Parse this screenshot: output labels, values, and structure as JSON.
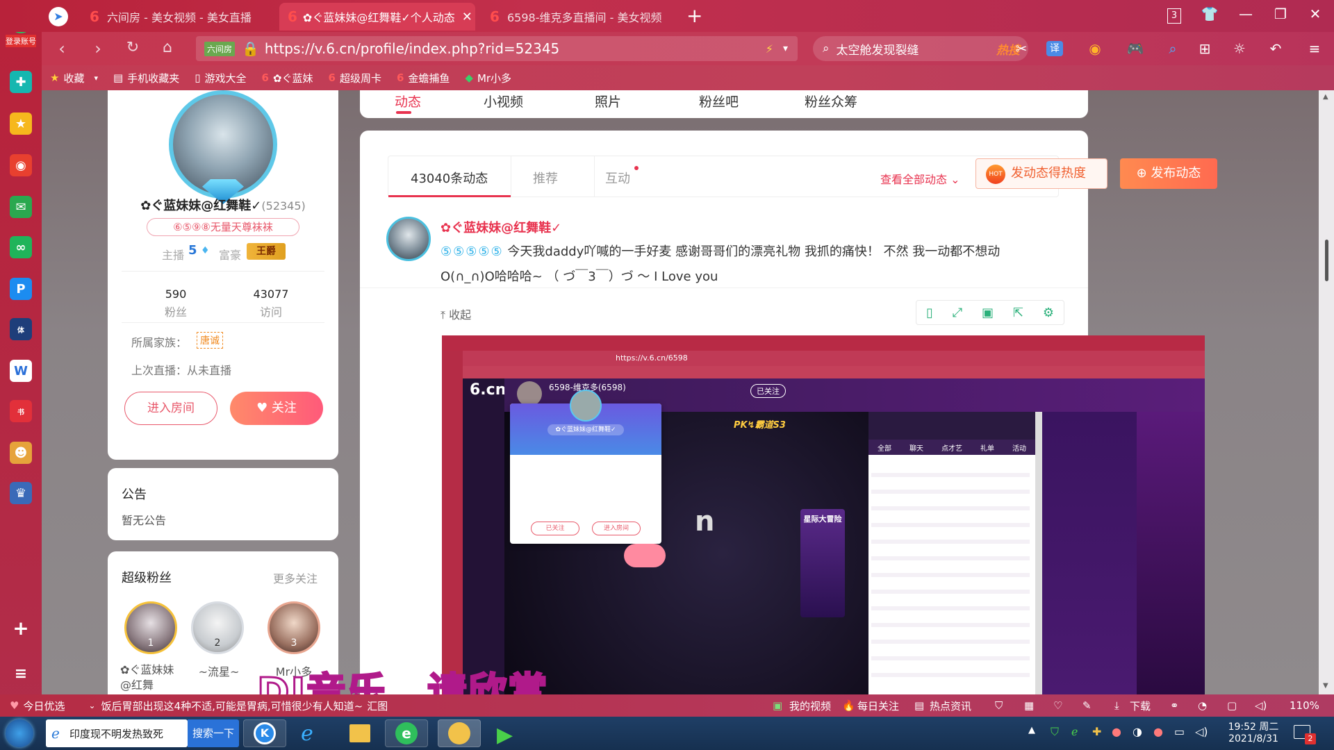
{
  "browser": {
    "sidebar_logo_label": "登录账号",
    "tabs": [
      {
        "label": "六间房 - 美女视频 - 美女直播",
        "active": false
      },
      {
        "label": "✿ぐ蓝妹妹@红舞鞋✓个人动态",
        "active": true
      },
      {
        "label": "6598-维克多直播间 - 美女视频",
        "active": false
      }
    ],
    "new_tab": "+",
    "tab_counter": "3",
    "url_tag": "六间房",
    "url": "https://v.6.cn/profile/index.php?rid=52345",
    "search_text": "太空舱发现裂缝",
    "search_hot": "热搜",
    "translate": "译",
    "bookmarks": [
      "收藏",
      "手机收藏夹",
      "游戏大全",
      "✿ぐ蓝妹",
      "超级周卡",
      "金蟾捕鱼",
      "Mr小多"
    ]
  },
  "profile": {
    "tabs": [
      "动态",
      "小视频",
      "照片",
      "粉丝吧",
      "粉丝众筹"
    ],
    "name": "✿ぐ蓝妹妹@红舞鞋✓",
    "rid": "(52345)",
    "badge": "⑥⑤⑨⑧无量天尊袜袜",
    "anchor_label": "主播",
    "anchor_level": "5",
    "rich_label": "富豪",
    "rich_badge": "王爵",
    "fans_count": "590",
    "fans_label": "粉丝",
    "visits_count": "43077",
    "visits_label": "访问",
    "family_label": "所属家族：",
    "family_value": "唐诚",
    "last_live_label": "上次直播：从未直播",
    "enter_room": "进入房间",
    "follow": "关注"
  },
  "notice": {
    "title": "公告",
    "text": "暂无公告"
  },
  "superfans": {
    "title": "超级粉丝",
    "more": "更多关注",
    "fans": [
      {
        "rank": "1",
        "name": "✿ぐ蓝妹妹@红舞"
      },
      {
        "rank": "2",
        "name": "~流星~"
      },
      {
        "rank": "3",
        "name": "Mr小多"
      }
    ]
  },
  "feed": {
    "tabs": [
      "43040条动态",
      "推荐",
      "互动"
    ],
    "view_all": "查看全部动态",
    "hot_post": "发动态得热度",
    "publish": "发布动态",
    "author": "✿ぐ蓝妹妹@红舞鞋✓",
    "post_line1": "今天我daddy吖喊的一手好麦 感谢哥哥们的漂亮礼物 我抓的痛快！ 不然 我一动都不想动",
    "post_line2": "O(∩_∩)O哈哈哈~ （ づ￣3￣）づ ～ I Love you",
    "collapse": "收起"
  },
  "embedded": {
    "url": "https://v.6.cn/6598",
    "room_title": "6598-维克多(6598)",
    "follow_done": "已关注",
    "chat_tabs": [
      "全部",
      "聊天",
      "点才艺",
      "礼单",
      "活动"
    ],
    "popup_name": "✿ぐ蓝妹妹@红舞鞋✓",
    "popup_unfollow": "已关注",
    "popup_enter": "进入房间",
    "pk_label": "PK↯霸道S3",
    "adventure": "星际大冒险",
    "subtitle": "DJ音乐，请欣赏"
  },
  "bottombar": {
    "today": "今日优选",
    "news": "饭后胃部出现这4种不适,可能是胃病,可惜很少有人知道~",
    "news_more": "汇图",
    "my_video": "我的视频",
    "daily": "每日关注",
    "hot_news": "热点资讯",
    "download": "下载",
    "zoom": "110%"
  },
  "taskbar": {
    "news_item": "印度现不明发热致死",
    "search_btn": "搜索一下",
    "time": "19:52 周二",
    "date": "2021/8/31",
    "notify_count": "2"
  },
  "colors": {
    "accent": "#e8334f",
    "orange": "#ff6a3d",
    "brand_red": "#b8223a"
  }
}
